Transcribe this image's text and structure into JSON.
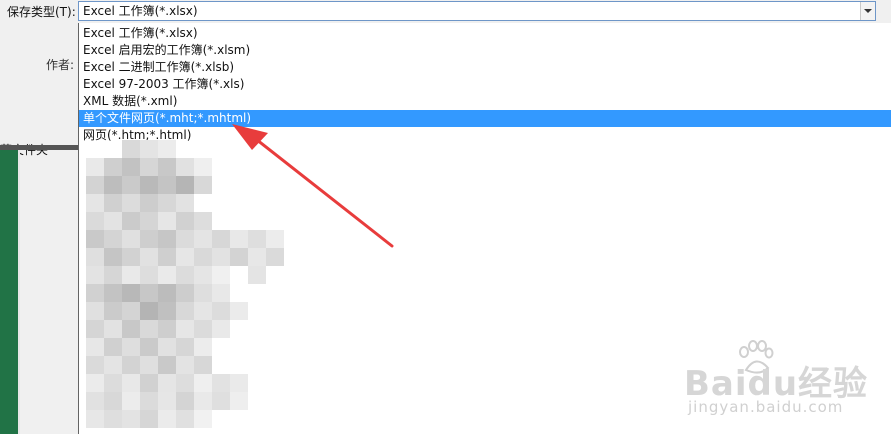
{
  "save_type": {
    "label": "保存类型(T):",
    "selected_value": "Excel 工作簿(*.xlsx)"
  },
  "left_panel": {
    "author_label": "作者:",
    "hide_folder_label": "藏文件夹"
  },
  "dropdown": {
    "options": [
      "Excel 工作簿(*.xlsx)",
      "Excel 启用宏的工作簿(*.xlsm)",
      "Excel 二进制工作簿(*.xlsb)",
      "Excel 97-2003 工作簿(*.xls)",
      "XML 数据(*.xml)",
      "单个文件网页(*.mht;*.mhtml)",
      "网页(*.htm;*.html)"
    ],
    "highlighted_index": 5
  },
  "watermark": {
    "brand": "Baidu经验",
    "url": "jingyan.baidu.com"
  },
  "colors": {
    "highlight": "#3399ff",
    "annotation_arrow": "#e83c3c",
    "excel_green": "#217346"
  }
}
